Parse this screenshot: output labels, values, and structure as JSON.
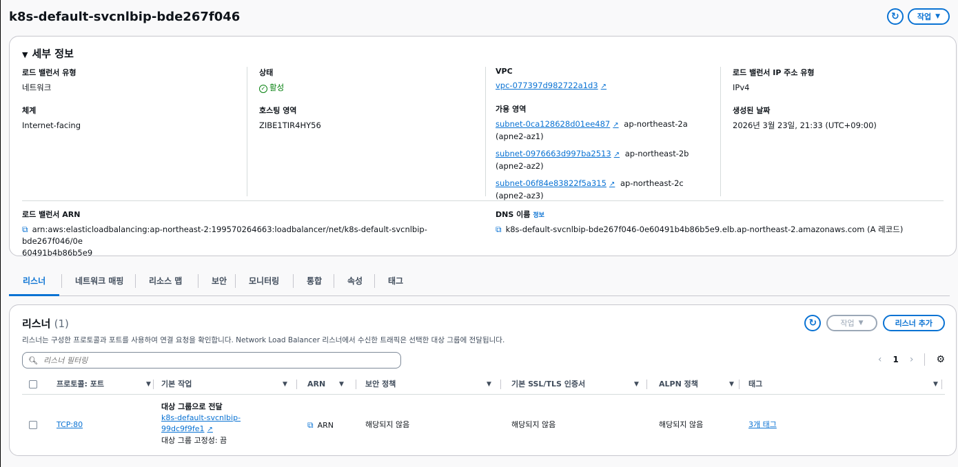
{
  "header": {
    "title": "k8s-default-svcnlbip-bde267f046",
    "refresh_icon": "refresh-icon",
    "actions_label": "작업"
  },
  "details": {
    "section_title": "세부 정보",
    "lb_type_label": "로드 밸런서 유형",
    "lb_type_value": "네트워크",
    "scheme_label": "체계",
    "scheme_value": "Internet-facing",
    "state_label": "상태",
    "state_value": "활성",
    "hosted_zone_label": "호스팅 영역",
    "hosted_zone_value": "ZIBE1TIR4HY56",
    "vpc_label": "VPC",
    "vpc_value": "vpc-077397d982722a1d3",
    "az_label": "가용 영역",
    "subnets": [
      {
        "id": "subnet-0ca128628d01ee487",
        "zone": "ap-northeast-2a",
        "az": "(apne2-az1)"
      },
      {
        "id": "subnet-0976663d997ba2513",
        "zone": "ap-northeast-2b",
        "az": "(apne2-az2)"
      },
      {
        "id": "subnet-06f84e83822f5a315",
        "zone": "ap-northeast-2c",
        "az": "(apne2-az3)"
      }
    ],
    "ip_type_label": "로드 밸런서 IP 주소 유형",
    "ip_type_value": "IPv4",
    "created_label": "생성된 날짜",
    "created_value": "2026년 3월 23일, 21:33 (UTC+09:00)",
    "arn_label": "로드 밸런서 ARN",
    "arn_line1": "arn:aws:elasticloadbalancing:ap-northeast-2:199570264663:loadbalancer/net/k8s-default-svcnlbip-bde267f046/0e",
    "arn_line2": "60491b4b86b5e9",
    "dns_label": "DNS 이름",
    "dns_info": "정보",
    "dns_value": "k8s-default-svcnlbip-bde267f046-0e60491b4b86b5e9.elb.ap-northeast-2.amazonaws.com (A 레코드)"
  },
  "tabs": [
    "리스너",
    "네트워크 매핑",
    "리소스 맵",
    "보안",
    "모니터링",
    "통합",
    "속성",
    "태그"
  ],
  "listeners": {
    "title": "리스너",
    "count": "(1)",
    "description": "리스너는 구성한 프로토콜과 포트를 사용하여 연결 요청을 확인합니다. Network Load Balancer 리스너에서 수신한 트래픽은 선택한 대상 그룹에 전달됩니다.",
    "actions_label": "작업",
    "add_label": "리스너 추가",
    "filter_placeholder": "리스너 필터링",
    "page": "1",
    "columns": [
      "프로토콜: 포트",
      "기본 작업",
      "ARN",
      "보안 정책",
      "기본 SSL/TLS 인증서",
      "ALPN 정책",
      "태그"
    ],
    "rows": [
      {
        "protocol_port": "TCP:80",
        "action_title": "대상 그룹으로 전달",
        "target_line1": "k8s-default-svcnlbip-",
        "target_line2": "99dc9f9fe1",
        "stickiness": "대상 그룹 고정성: 끔",
        "arn": "ARN",
        "security_policy": "해당되지 않음",
        "ssl_cert": "해당되지 않음",
        "alpn": "해당되지 않음",
        "tags": "3개 태그"
      }
    ]
  }
}
